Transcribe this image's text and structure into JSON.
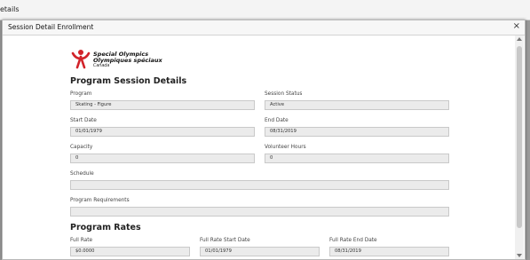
{
  "background": {
    "title": "etails"
  },
  "modal": {
    "title": "Session Detail Enrollment",
    "close_glyph": "×"
  },
  "logo": {
    "line1": "Special Olympics",
    "line2": "Olympiques spéciaux",
    "line3": "Canada",
    "color": "#d2232a"
  },
  "session_details": {
    "heading": "Program Session Details",
    "program": {
      "label": "Program",
      "value": "Skating - Figure"
    },
    "session_status": {
      "label": "Session Status",
      "value": "Active"
    },
    "start_date": {
      "label": "Start Date",
      "value": "01/01/1979"
    },
    "end_date": {
      "label": "End Date",
      "value": "08/31/2019"
    },
    "capacity": {
      "label": "Capacity",
      "value": "0"
    },
    "volunteer_hours": {
      "label": "Volunteer Hours",
      "value": "0"
    },
    "schedule": {
      "label": "Schedule",
      "value": ""
    },
    "program_requirements": {
      "label": "Program Requirements",
      "value": ""
    }
  },
  "program_rates": {
    "heading": "Program Rates",
    "full_rate": {
      "label": "Full Rate",
      "value": "$0.0000"
    },
    "full_rate_start_date": {
      "label": "Full Rate Start Date",
      "value": "01/01/1979"
    },
    "full_rate_end_date": {
      "label": "Full Rate End Date",
      "value": "08/31/2019"
    }
  }
}
